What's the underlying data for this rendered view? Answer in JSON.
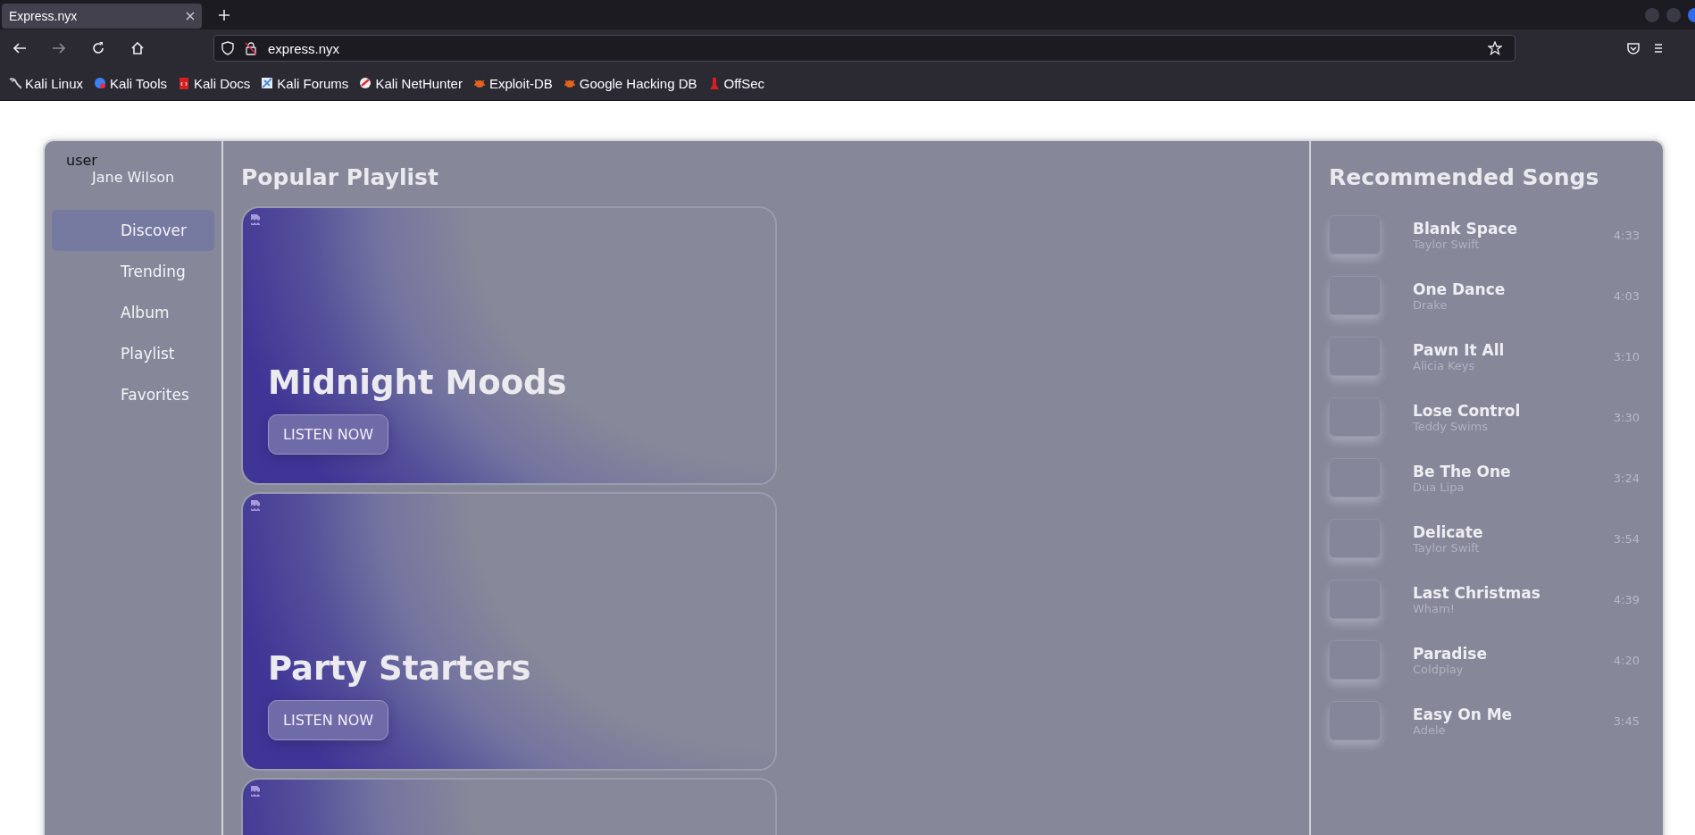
{
  "browser": {
    "tabs": [
      {
        "title": "Express.nyx",
        "selected": true
      }
    ],
    "url": "express.nyx",
    "bookmarks": [
      {
        "label": "Kali Linux"
      },
      {
        "label": "Kali Tools"
      },
      {
        "label": "Kali Docs"
      },
      {
        "label": "Kali Forums"
      },
      {
        "label": "Kali NetHunter"
      },
      {
        "label": "Exploit-DB"
      },
      {
        "label": "Google Hacking DB"
      },
      {
        "label": "OffSec"
      }
    ]
  },
  "sidebar": {
    "user_label": "user",
    "user_name": "Jane Wilson",
    "items": [
      {
        "label": "Discover",
        "selected": true
      },
      {
        "label": "Trending",
        "selected": false
      },
      {
        "label": "Album",
        "selected": false
      },
      {
        "label": "Playlist",
        "selected": false
      },
      {
        "label": "Favorites",
        "selected": false
      }
    ]
  },
  "main": {
    "heading": "Popular Playlist",
    "cards": [
      {
        "kind": "full",
        "title": "Midnight Moods",
        "button": "LISTEN NOW"
      },
      {
        "kind": "full",
        "title": "Party Starters",
        "button": "LISTEN NOW"
      },
      {
        "kind": "cut_off"
      }
    ]
  },
  "recommended": {
    "heading": "Recommended Songs",
    "songs": [
      {
        "title": "Blank Space",
        "artist": "Taylor Swift",
        "duration": "4:33"
      },
      {
        "title": "One Dance",
        "artist": "Drake",
        "duration": "4:03"
      },
      {
        "title": "Pawn It All",
        "artist": "Alicia Keys",
        "duration": "3:10"
      },
      {
        "title": "Lose Control",
        "artist": "Teddy Swims",
        "duration": "3:30"
      },
      {
        "title": "Be The One",
        "artist": "Dua Lipa",
        "duration": "3:24"
      },
      {
        "title": "Delicate",
        "artist": "Taylor Swift",
        "duration": "3:54"
      },
      {
        "title": "Last Christmas",
        "artist": "Wham!",
        "duration": "4:39"
      },
      {
        "title": "Paradise",
        "artist": "Coldplay",
        "duration": "4:20"
      },
      {
        "title": "Easy On Me",
        "artist": "Adele",
        "duration": "3:45"
      }
    ]
  }
}
